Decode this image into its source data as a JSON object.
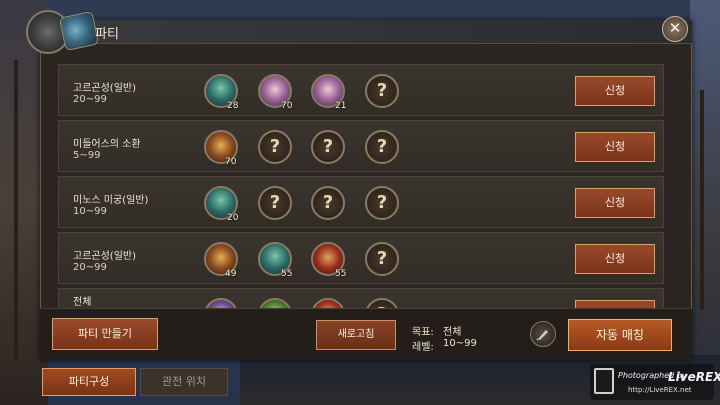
{
  "window": {
    "title": "파티"
  },
  "rows": [
    {
      "name": "고르곤성(일반)",
      "level": "20~99",
      "slot_levels": [
        "28",
        "70",
        "21",
        ""
      ],
      "action": "신청"
    },
    {
      "name": "미들어스의 소환",
      "level": "5~99",
      "slot_levels": [
        "70",
        "",
        "",
        ""
      ],
      "action": "신청"
    },
    {
      "name": "미노스 미궁(일반)",
      "level": "10~99",
      "slot_levels": [
        "20",
        "",
        "",
        ""
      ],
      "action": "신청"
    },
    {
      "name": "고르곤성(일반)",
      "level": "20~99",
      "slot_levels": [
        "49",
        "55",
        "55",
        ""
      ],
      "action": "신청"
    },
    {
      "name": "전체",
      "level": "",
      "slot_levels": [
        "",
        "",
        "",
        ""
      ],
      "action": ""
    }
  ],
  "empty_slot_glyph": "?",
  "bottom": {
    "create_party": "파티 만들기",
    "refresh": "새로고침",
    "target_label": "목표:",
    "target_value": "전체",
    "level_label": "레벨:",
    "level_value": "10~99",
    "auto_match": "자동 매칭"
  },
  "tabs": [
    {
      "label": "파티구성",
      "active": true
    },
    {
      "label": "관전 위치",
      "active": false
    }
  ],
  "close_glyph": "✕",
  "watermark": {
    "brand": "LiveREX",
    "url": "http://LiveREX.net",
    "sign": "Photographed by"
  }
}
